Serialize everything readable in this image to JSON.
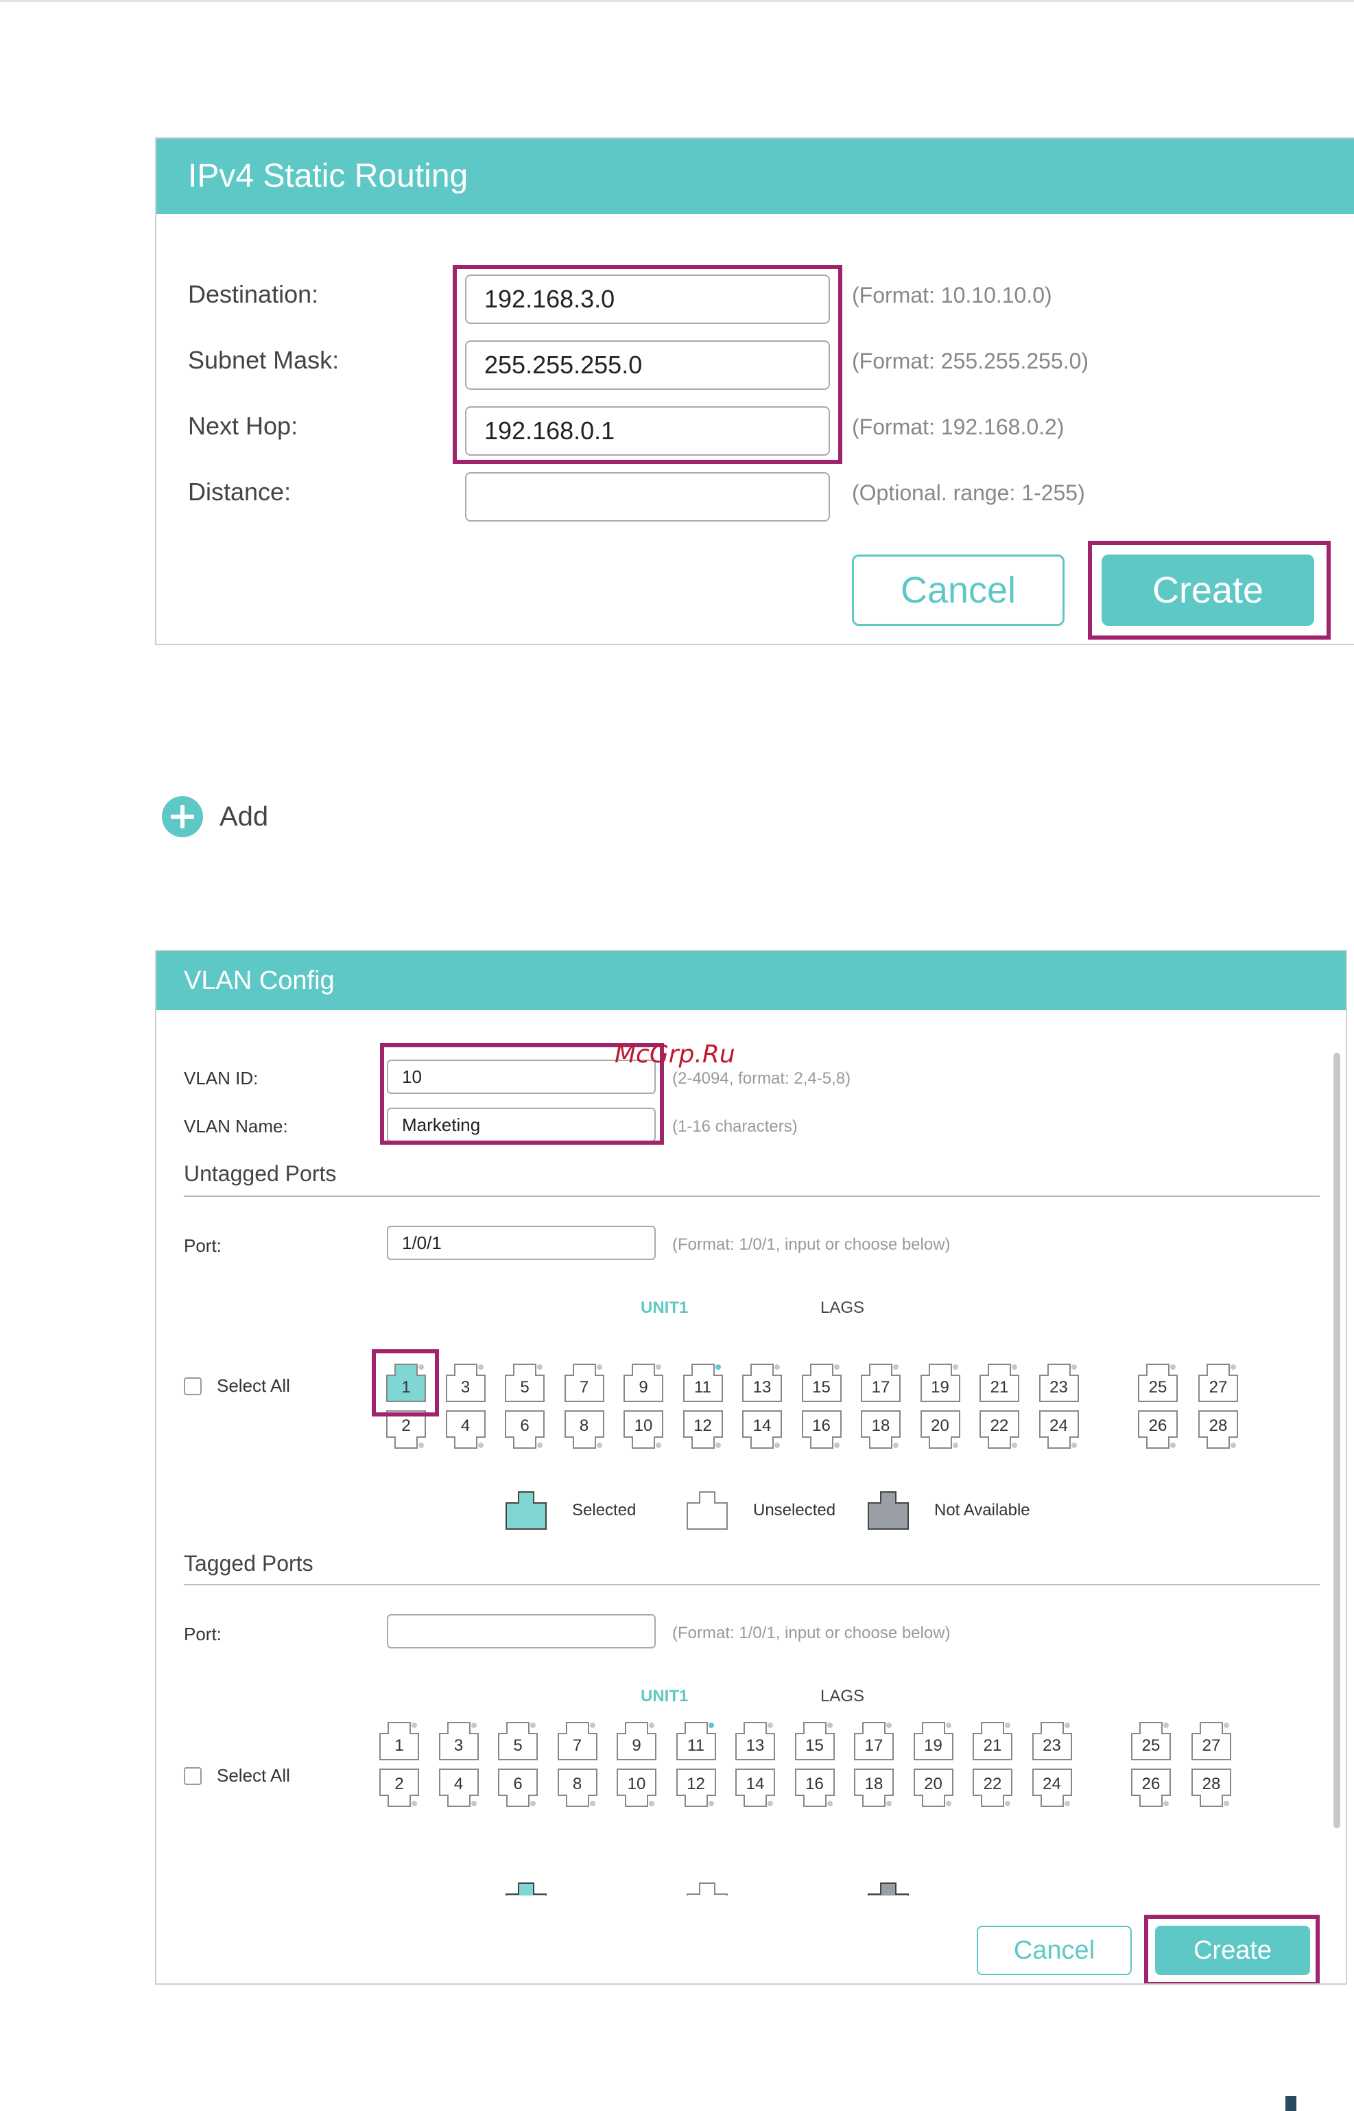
{
  "static_routing": {
    "title": "IPv4 Static Routing",
    "rows": [
      {
        "label": "Destination:",
        "value": "192.168.3.0",
        "hint": "(Format: 10.10.10.0)"
      },
      {
        "label": "Subnet Mask:",
        "value": "255.255.255.0",
        "hint": "(Format: 255.255.255.0)"
      },
      {
        "label": "Next Hop:",
        "value": "192.168.0.1",
        "hint": "(Format: 192.168.0.2)"
      },
      {
        "label": "Distance:",
        "value": "",
        "hint": "(Optional. range: 1-255)"
      }
    ],
    "cancel_label": "Cancel",
    "create_label": "Create"
  },
  "add": {
    "label": "Add",
    "icon": "plus-circle-icon"
  },
  "vlan_config": {
    "title": "VLAN Config",
    "watermark": "McGrp.Ru",
    "vlan_id": {
      "label": "VLAN ID:",
      "value": "10",
      "hint": "(2-4094, format: 2,4-5,8)"
    },
    "vlan_name": {
      "label": "VLAN Name:",
      "value": "Marketing",
      "hint": "(1-16 characters)"
    },
    "untagged": {
      "section": "Untagged Ports",
      "port_label": "Port:",
      "port_value": "1/0/1",
      "port_hint": "(Format: 1/0/1, input or choose below)",
      "unit_label": "UNIT1",
      "lags_label": "LAGS",
      "select_all": "Select All",
      "selected_ports": [
        "1"
      ]
    },
    "tagged": {
      "section": "Tagged Ports",
      "port_label": "Port:",
      "port_value": "",
      "port_hint": "(Format: 1/0/1, input or choose below)",
      "unit_label": "UNIT1",
      "lags_label": "LAGS",
      "select_all": "Select All",
      "selected_ports": []
    },
    "unit_ports_odd": [
      "1",
      "3",
      "5",
      "7",
      "9",
      "11",
      "13",
      "15",
      "17",
      "19",
      "21",
      "23"
    ],
    "unit_ports_even": [
      "2",
      "4",
      "6",
      "8",
      "10",
      "12",
      "14",
      "16",
      "18",
      "20",
      "22",
      "24"
    ],
    "lag_ports_odd": [
      "25",
      "27"
    ],
    "lag_ports_even": [
      "26",
      "28"
    ],
    "linked_port": "11",
    "legend": [
      {
        "label": "Selected",
        "color": "#7fd6d2"
      },
      {
        "label": "Unselected",
        "color": "#ffffff"
      },
      {
        "label": "Not Available",
        "color": "#9a9fa5"
      }
    ],
    "cancel_label": "Cancel",
    "create_label": "Create"
  },
  "colors": {
    "accent": "#5ec8c6",
    "highlight": "#a0246c",
    "hint": "#999999"
  }
}
